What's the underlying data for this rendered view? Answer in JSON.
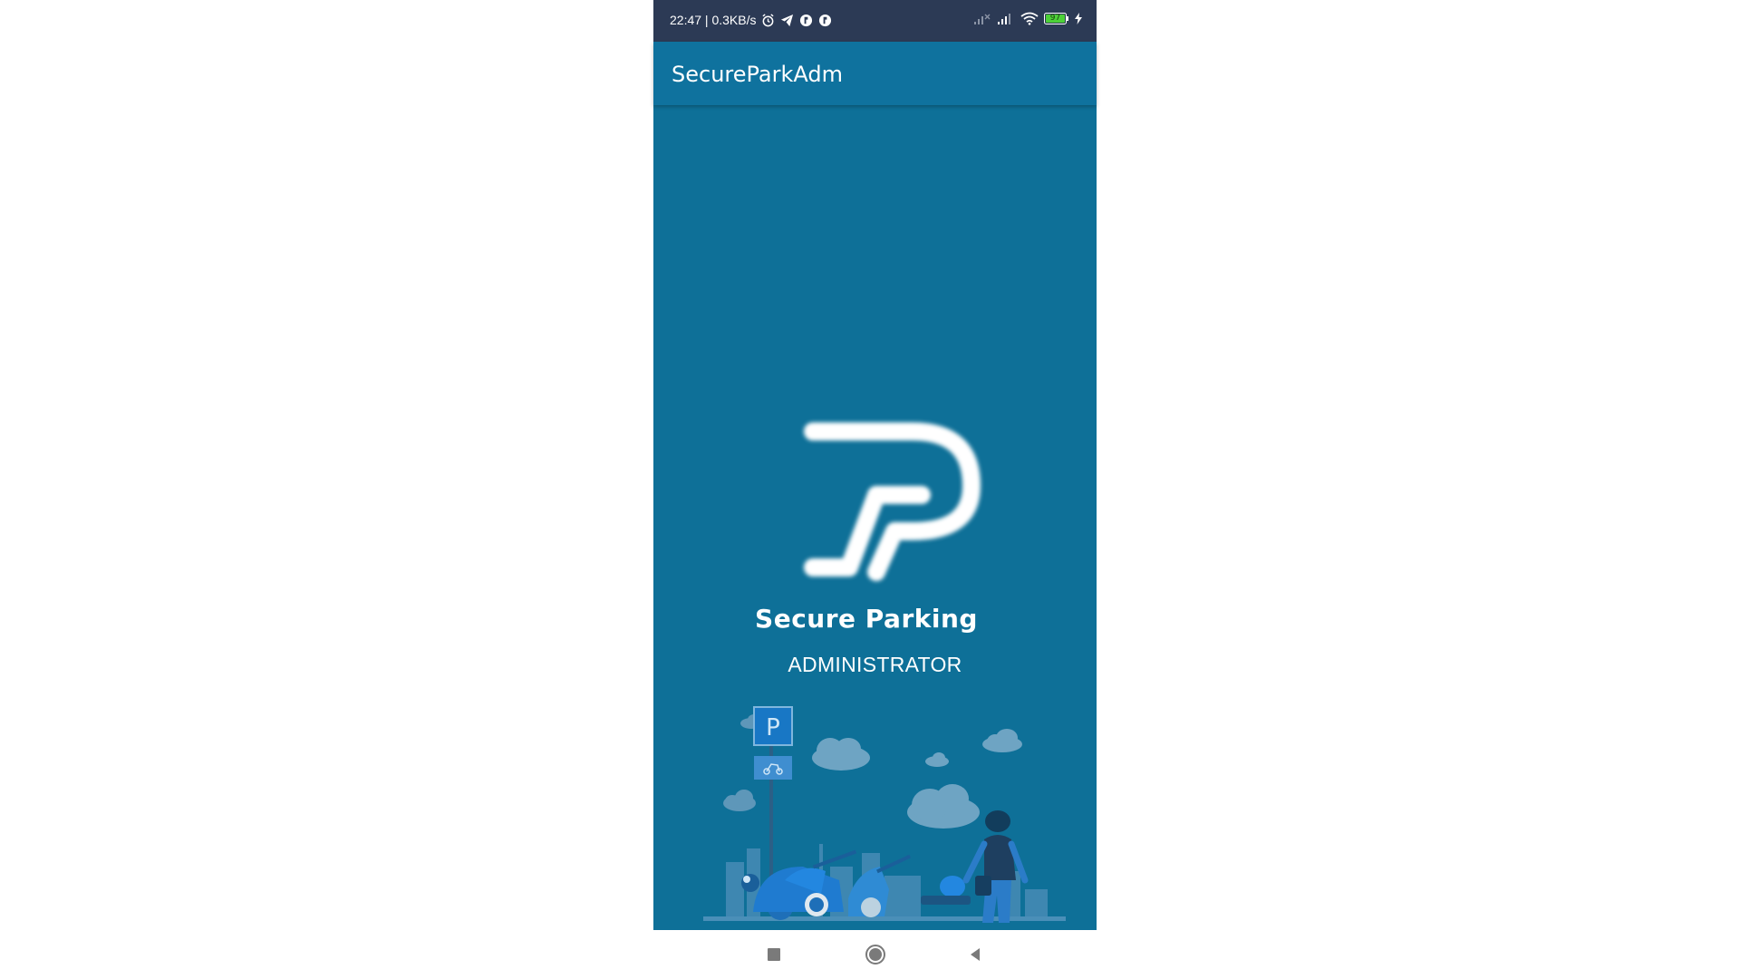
{
  "status_bar": {
    "time_speed": "22:47 | 0.3KB/s",
    "battery_level": "97",
    "icons": [
      "alarm-icon",
      "telegram-icon",
      "app-icon",
      "app-icon",
      "signal-icon",
      "signal-icon",
      "wifi-icon",
      "battery-icon",
      "charging-icon"
    ]
  },
  "app_bar": {
    "title": "SecureParkAdm"
  },
  "splash": {
    "brand_name": "Secure Parking",
    "subtitle": "ADMINISTRATOR",
    "logo": "sp-logo",
    "illustration": "parking-scene-illustration",
    "sign_letter": "P"
  },
  "nav": {
    "icons": [
      "recents-icon",
      "home-icon",
      "back-icon"
    ]
  },
  "colors": {
    "status_bar": "#2c3a55",
    "app_bar": "#0f729e",
    "background": "#0e7098",
    "text": "#ffffff"
  }
}
